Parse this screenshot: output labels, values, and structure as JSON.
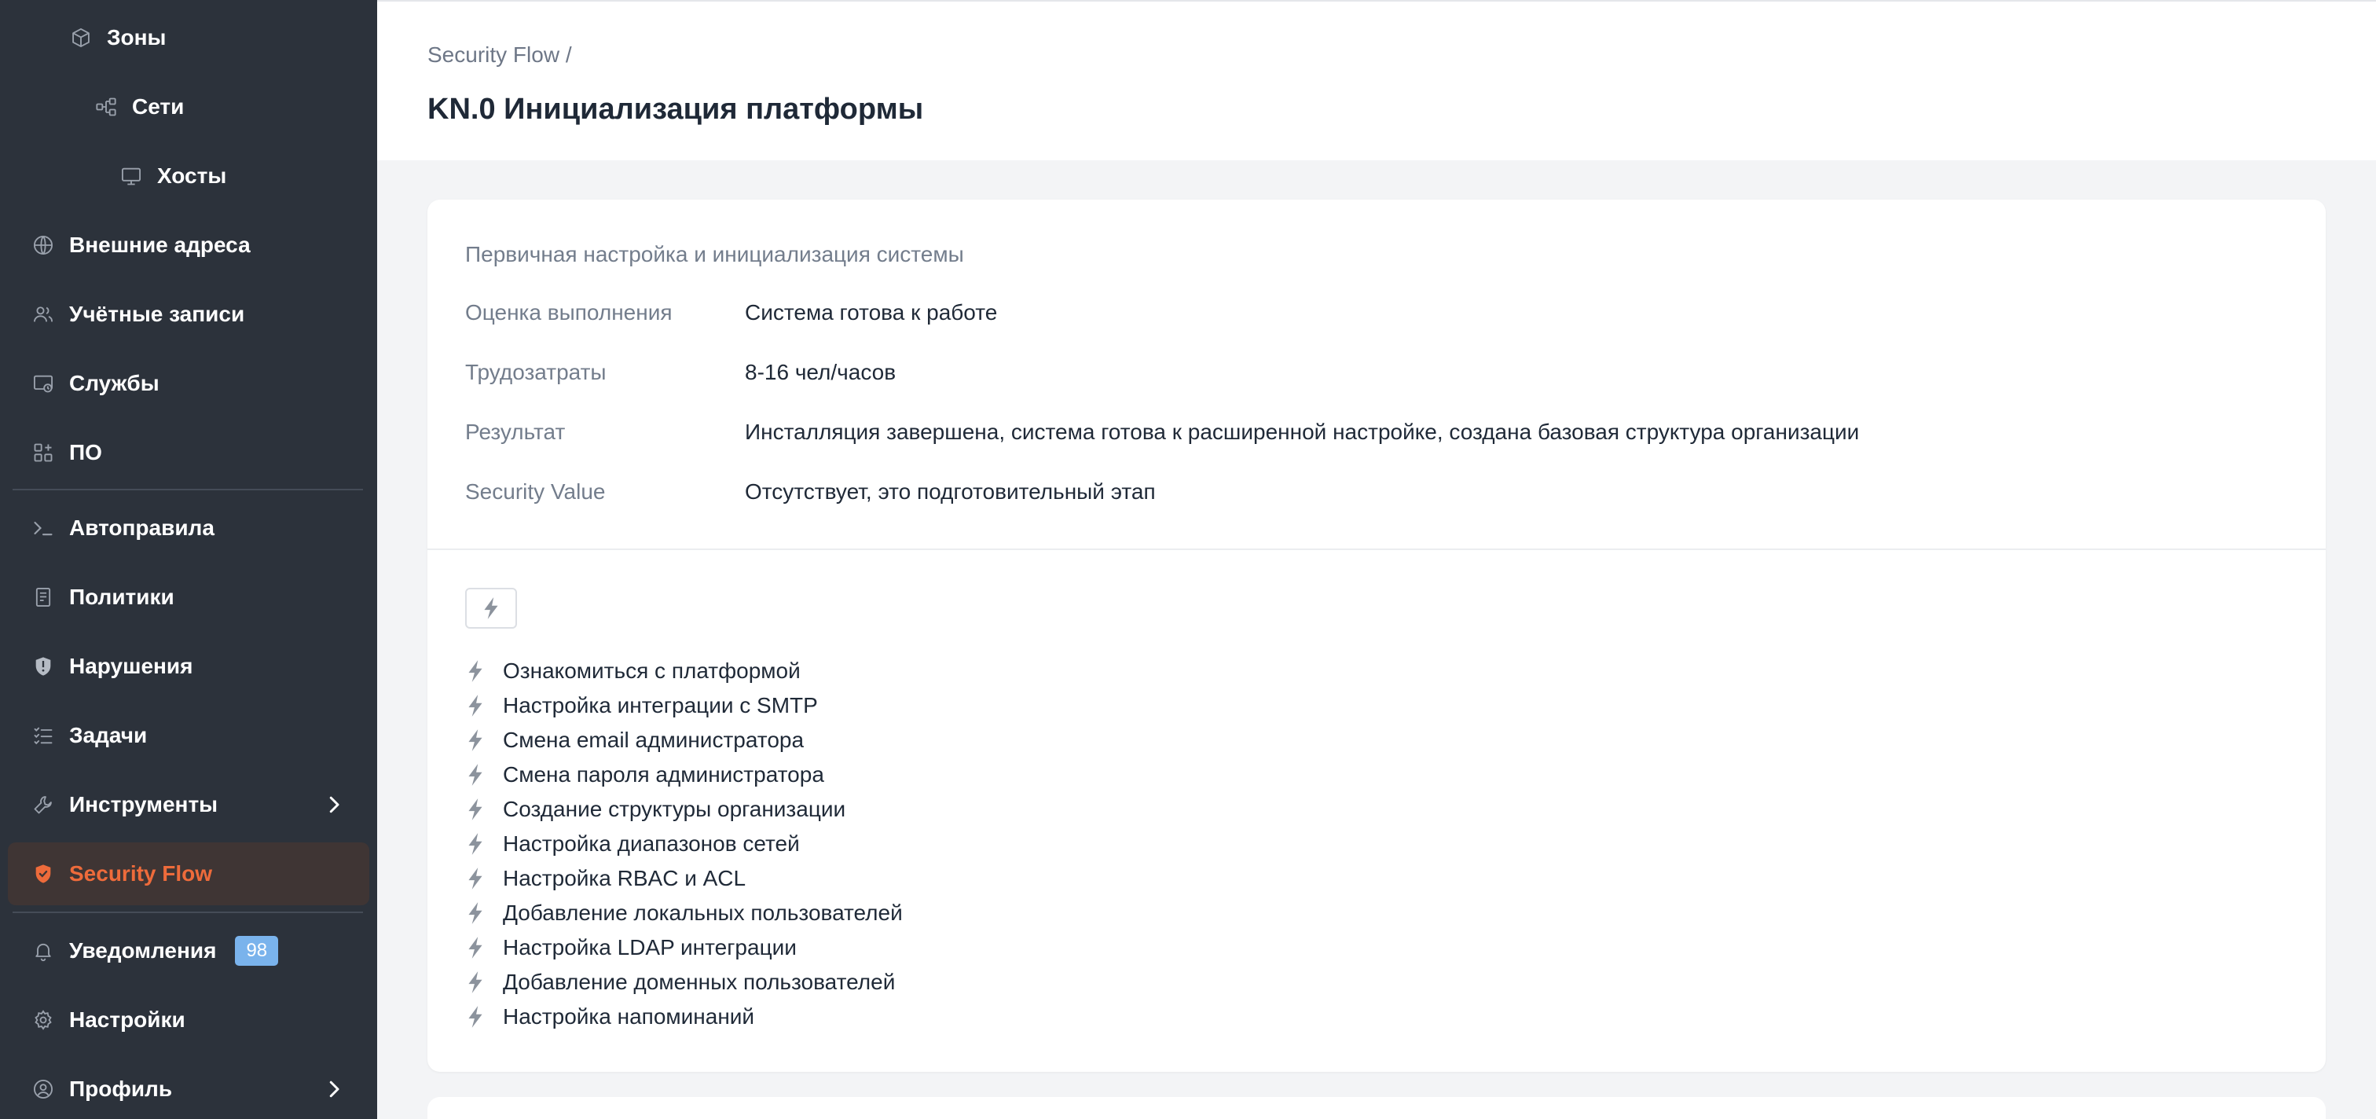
{
  "sidebar": {
    "items": [
      {
        "name": "sidebar-item-zones",
        "label": "Зоны",
        "icon": "cube-icon"
      },
      {
        "name": "sidebar-item-networks",
        "label": "Сети",
        "icon": "network-icon"
      },
      {
        "name": "sidebar-item-hosts",
        "label": "Хосты",
        "icon": "monitor-icon"
      },
      {
        "name": "sidebar-item-external-addresses",
        "label": "Внешние адреса",
        "icon": "globe-icon"
      },
      {
        "name": "sidebar-item-accounts",
        "label": "Учётные записи",
        "icon": "users-icon"
      },
      {
        "name": "sidebar-item-services",
        "label": "Службы",
        "icon": "services-icon"
      },
      {
        "name": "sidebar-item-software",
        "label": "ПО",
        "icon": "apps-icon"
      },
      {
        "name": "sidebar-item-autorules",
        "label": "Автоправила",
        "icon": "terminal-icon"
      },
      {
        "name": "sidebar-item-policies",
        "label": "Политики",
        "icon": "document-icon"
      },
      {
        "name": "sidebar-item-violations",
        "label": "Нарушения",
        "icon": "shield-alert-icon"
      },
      {
        "name": "sidebar-item-tasks",
        "label": "Задачи",
        "icon": "checklist-icon"
      },
      {
        "name": "sidebar-item-tools",
        "label": "Инструменты",
        "icon": "wrench-icon"
      },
      {
        "name": "sidebar-item-security-flow",
        "label": "Security Flow",
        "icon": "shield-icon"
      },
      {
        "name": "sidebar-item-notifications",
        "label": "Уведомления",
        "icon": "bell-icon",
        "badge": "98"
      },
      {
        "name": "sidebar-item-settings",
        "label": "Настройки",
        "icon": "gear-icon"
      },
      {
        "name": "sidebar-item-profile",
        "label": "Профиль",
        "icon": "user-circle-icon"
      }
    ],
    "active": "Security Flow"
  },
  "header": {
    "breadcrumb": "Security Flow /",
    "title": "KN.0 Инициализация платформы"
  },
  "card": {
    "subtitle": "Первичная настройка и инициализация системы",
    "rows": [
      {
        "label": "Оценка выполнения",
        "value": "Система готова к работе"
      },
      {
        "label": "Трудозатраты",
        "value": "8-16 чел/часов"
      },
      {
        "label": "Результат",
        "value": "Инсталляция завершена, система готова к расширенной настройке, создана базовая структура организации"
      },
      {
        "label": "Security Value",
        "value": "Отсутствует, это подготовительный этап"
      }
    ],
    "tasks": [
      "Ознакомиться с платформой",
      "Настройка интеграции с SMTP",
      "Смена email администратора",
      "Смена пароля администратора",
      "Создание структуры организации",
      "Настройка диапазонов сетей",
      "Настройка RBAC и ACL",
      "Добавление локальных пользователей",
      "Настройка LDAP интеграции",
      "Добавление доменных пользователей",
      "Настройка напоминаний"
    ]
  },
  "colors": {
    "sidebar_bg": "#2c323b",
    "accent": "#ee6b3b",
    "active_bg": "#3f3534",
    "badge_bg": "#7ab3ec",
    "page_bg": "#f3f4f6"
  }
}
